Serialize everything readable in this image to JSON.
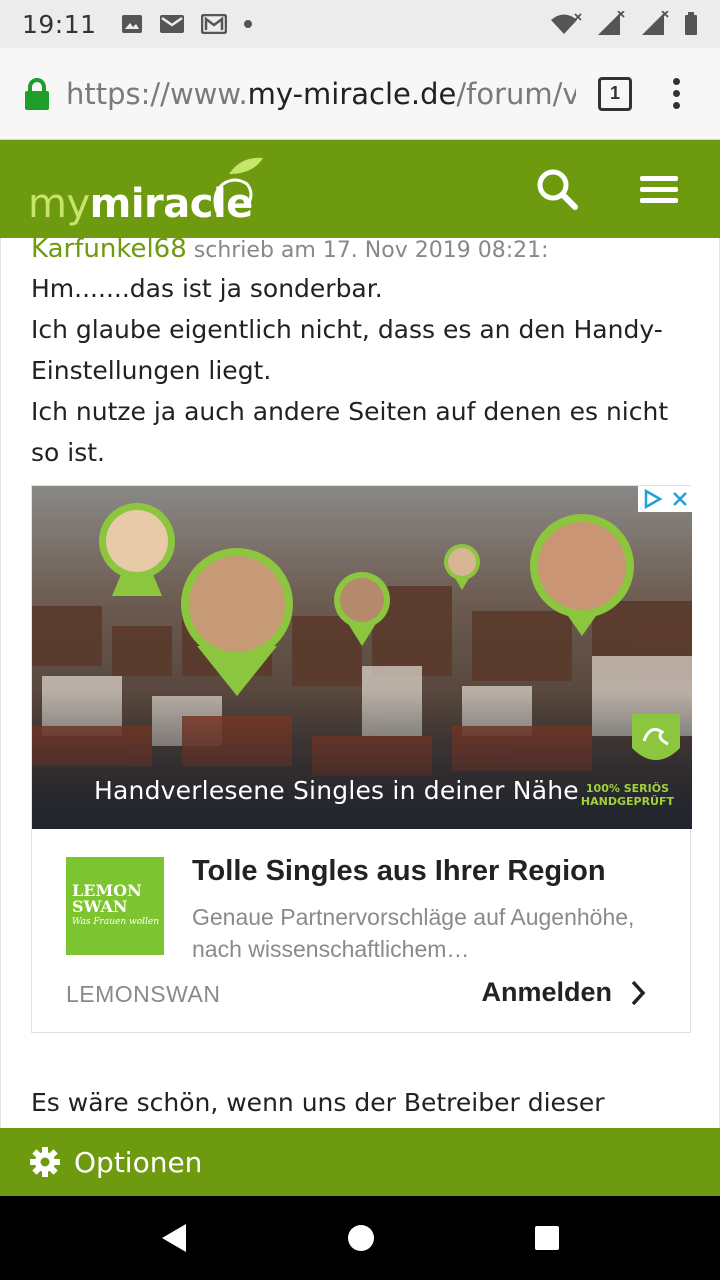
{
  "status_bar": {
    "time": "19:11"
  },
  "browser": {
    "url_scheme": "https://www.",
    "url_domain": "my-miracle.de",
    "url_path": "/forum/v",
    "tab_count": "1"
  },
  "site": {
    "logo_my": "my",
    "logo_miracle": "miracle"
  },
  "post": {
    "quote_author": "Karfunkel68",
    "quote_meta": " schrieb am 17. Nov 2019 08:21:",
    "paragraphs": [
      "Hm.......das ist ja sonderbar.",
      "Ich glaube eigentlich nicht, dass es an den Handy-Einstellungen liegt.",
      "Ich nutze ja auch andere Seiten auf denen es nicht so ist."
    ],
    "next_text": "Es wäre schön, wenn uns der Betreiber dieser"
  },
  "ad": {
    "image_caption": "Handverlesene Singles in deiner Nähe",
    "badge_line1": "100% SERIÖS",
    "badge_line2": "HANDGEPRÜFT",
    "logo_line1": "LEMON",
    "logo_line2": "SWAN",
    "logo_tagline": "Was Frauen wollen",
    "title": "Tolle Singles aus Ihrer Region",
    "description": "Genaue Partnervorschläge auf Augenhöhe, nach wissenschaftlichem…",
    "advertiser": "LEMONSWAN",
    "cta": "Anmelden"
  },
  "options": {
    "label": "Optionen"
  },
  "colors": {
    "brand_green": "#6e9a10",
    "pin_green": "#8cc63f"
  }
}
